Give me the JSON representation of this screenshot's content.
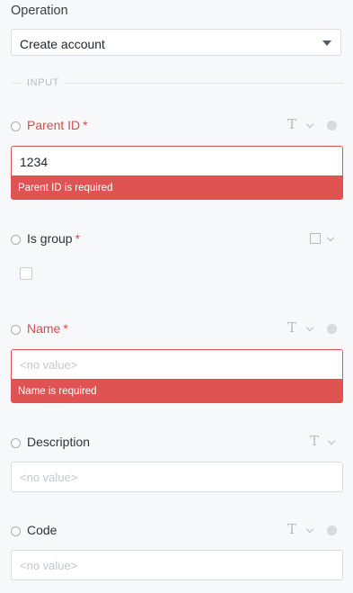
{
  "operation": {
    "label": "Operation",
    "selected": "Create account"
  },
  "section": {
    "label": "INPUT"
  },
  "fields": {
    "parent_id": {
      "label": "Parent ID",
      "required_mark": "*",
      "value": "1234",
      "error": "Parent ID is required",
      "type_icon": "text-type-icon"
    },
    "is_group": {
      "label": "Is group",
      "required_mark": "*",
      "type_icon": "checkbox-type-icon"
    },
    "name": {
      "label": "Name",
      "required_mark": "*",
      "placeholder": "<no value>",
      "error": "Name is required",
      "type_icon": "text-type-icon"
    },
    "description": {
      "label": "Description",
      "placeholder": "<no value>",
      "type_icon": "text-type-icon"
    },
    "code": {
      "label": "Code",
      "placeholder": "<no value>",
      "type_icon": "text-type-icon"
    }
  },
  "glyphs": {
    "text_type": "T"
  },
  "colors": {
    "error": "#e05353",
    "label_error": "#d84b4b",
    "background": "#f7f8fa"
  }
}
